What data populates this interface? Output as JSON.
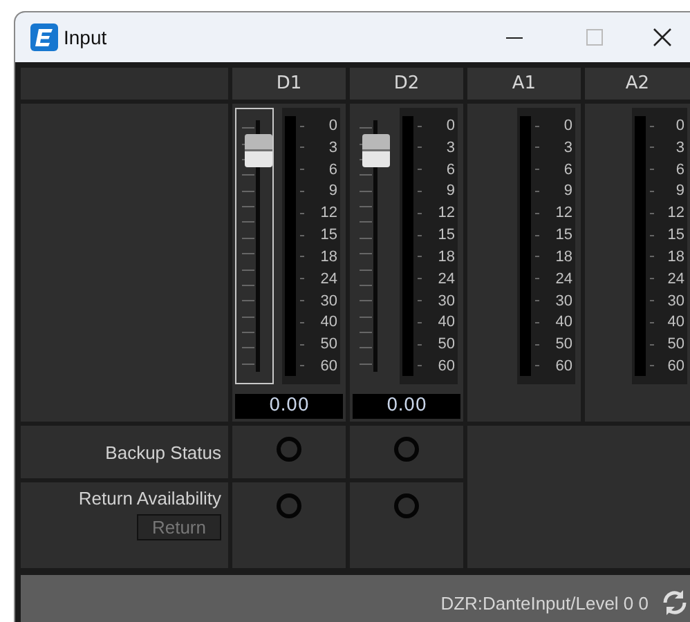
{
  "window": {
    "title": "Input"
  },
  "channels": [
    {
      "name": "D1",
      "kind": "fader",
      "selected": true,
      "level": 0.86,
      "value": "0.00",
      "scale": [
        "0",
        "3",
        "6",
        "9",
        "12",
        "15",
        "18",
        "24",
        "30",
        "40",
        "50",
        "60"
      ],
      "backup_on": false,
      "return_on": false
    },
    {
      "name": "D2",
      "kind": "fader",
      "selected": false,
      "level": 0.86,
      "value": "0.00",
      "scale": [
        "0",
        "3",
        "6",
        "9",
        "12",
        "15",
        "18",
        "24",
        "30",
        "40",
        "50",
        "60"
      ],
      "backup_on": false,
      "return_on": false
    },
    {
      "name": "A1",
      "kind": "meter",
      "scale": [
        "0",
        "3",
        "6",
        "9",
        "12",
        "15",
        "18",
        "24",
        "30",
        "40",
        "50",
        "60"
      ]
    },
    {
      "name": "A2",
      "kind": "meter",
      "scale": [
        "0",
        "3",
        "6",
        "9",
        "12",
        "15",
        "18",
        "24",
        "30",
        "40",
        "50",
        "60"
      ]
    }
  ],
  "rows": {
    "backup_label": "Backup Status",
    "return_label": "Return Availability",
    "return_button": {
      "label": "Return",
      "disabled": true
    }
  },
  "status_bar": {
    "text": "DZR:DanteInput/Level 0 0"
  }
}
